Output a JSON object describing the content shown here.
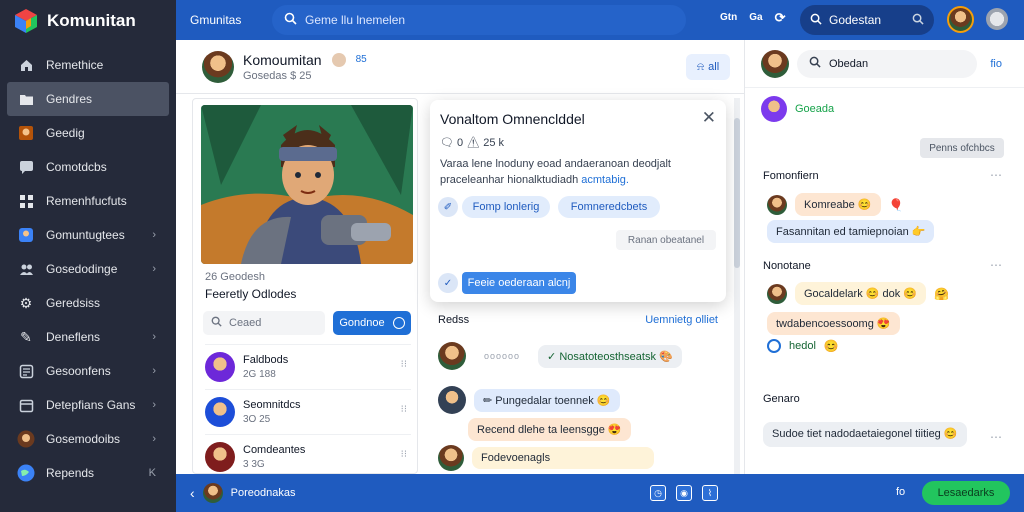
{
  "app": {
    "title": "Komunitan"
  },
  "sidebar": {
    "items": [
      {
        "label": "Remethice",
        "icon": "home-icon"
      },
      {
        "label": "Gendres",
        "icon": "folder-icon",
        "active": true
      },
      {
        "label": "Geedig",
        "icon": "game-icon"
      },
      {
        "label": "Comotdcbs",
        "icon": "chat-icon"
      },
      {
        "label": "Remenhfucfuts",
        "icon": "grid-icon"
      },
      {
        "label": "Gomuntugtees",
        "icon": "group-icon",
        "chevron": true
      },
      {
        "label": "Gosedodinge",
        "icon": "people-icon",
        "chevron": true
      },
      {
        "label": "Geredsiss",
        "icon": "gear-icon"
      },
      {
        "label": "Deneflens",
        "icon": "pencil-icon",
        "chevron": true
      },
      {
        "label": "Gesoonfens",
        "icon": "list-icon",
        "chevron": true
      },
      {
        "label": "Detepfians Gans",
        "icon": "calendar-icon",
        "chevron": true
      },
      {
        "label": "Gosemodoibs",
        "icon": "user-icon",
        "chevron": true
      },
      {
        "label": "Repends",
        "icon": "globe-icon",
        "shortcut": "K"
      }
    ]
  },
  "topbar": {
    "brand": "Gmunitas",
    "search_placeholder": "Geme llu lnemelen",
    "icons_text": [
      "Gtn",
      "Ga"
    ],
    "right_search": "Godestan"
  },
  "profile": {
    "name": "Komoumitan",
    "subtitle": "Gosedas $ 25",
    "badge": "85",
    "all_button": "all"
  },
  "left_card": {
    "meta": "26  Geodesh",
    "title": "Feeretly Odlodes",
    "search_placeholder": "Ceaed",
    "button": "Gondnoe",
    "friends": [
      {
        "name": "Faldbods",
        "sub": "2G 188"
      },
      {
        "name": "Seomnitdcs",
        "sub": "3O 25"
      },
      {
        "name": "Comdeantes",
        "sub": "3 3G"
      }
    ]
  },
  "popup": {
    "title": "Vonaltom Omnenclddel",
    "meta": "0 ⚠ 25 k",
    "body": "Varaa lene lnoduny eoad andaeranoan deodjalt praceleanhar hionalktudiadh",
    "link": "acmtabig.",
    "chips": [
      "Fomp lonlerig",
      "Fomneredcbets"
    ],
    "gray_button": "Ranan obeatanel",
    "action": "Feeie oederaan alcnj"
  },
  "feed": {
    "header": "Redss",
    "header_link": "Uemnietg olliet",
    "messages": [
      {
        "text": "Nosatoteosthseatsk",
        "dots": "oooooo"
      },
      {
        "text": "Pungedalar toennek"
      },
      {
        "text": "Recend dlehe ta leensgge"
      },
      {
        "text": "Fodevoenagls"
      }
    ]
  },
  "right_panel": {
    "search": "Obedan",
    "close": "fio",
    "user": "Goeada",
    "button": "Penns ofchbcs",
    "section1": "Fomonfiern",
    "s1_items": [
      "Komreabe",
      "Fasannitan ed tamiepnoian"
    ],
    "section2": "Nonotane",
    "s2_items": [
      "Gocaldelark",
      "dok",
      "twdabencoessoomg",
      "hedol"
    ],
    "section3": "Genaro",
    "s3_item": "Sudoe tiet nadodaetaiegonel tiitieg"
  },
  "bottombar": {
    "user": "Poreodnakas",
    "arrow": "fo",
    "button": "Lesaedarks"
  },
  "colors": {
    "sidebar": "#252a3a",
    "topbar": "#1f5bbf",
    "accent": "#1f6fd6",
    "success": "#22c55e"
  }
}
